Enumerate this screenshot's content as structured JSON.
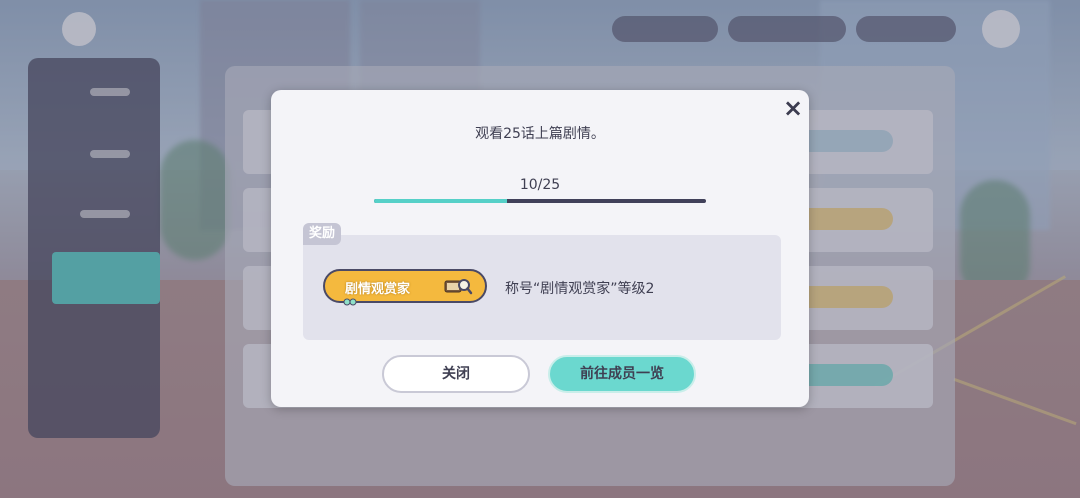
{
  "dialog": {
    "mission_title": "观看25话上篇剧情。",
    "progress_text": "10/25",
    "progress_fraction": 0.4,
    "reward_tag": "奖励",
    "badge_text": "剧情观赏家",
    "reward_description": "称号“剧情观赏家”等级2",
    "close_button_label": "关闭",
    "goto_button_label": "前往成员一览",
    "close_icon": "×"
  },
  "colors": {
    "accent_teal": "#56d0c8",
    "badge_gold": "#f4b93e",
    "text_dark": "#3f3f52"
  }
}
